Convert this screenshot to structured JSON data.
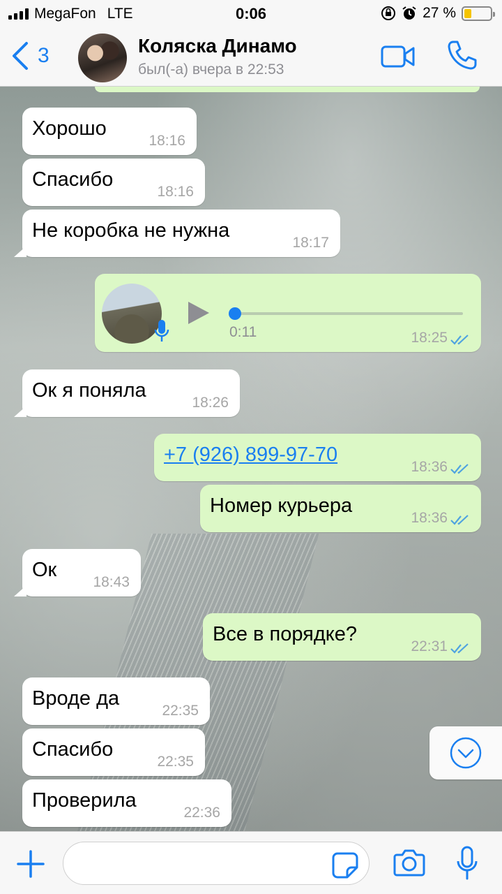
{
  "status_bar": {
    "carrier": "MegaFon",
    "network": "LTE",
    "time": "0:06",
    "battery_percent": "27 %",
    "battery_level": 0.27
  },
  "header": {
    "back_count": "3",
    "contact_name": "Коляска Динамо",
    "last_seen": "был(-а) вчера в 22:53"
  },
  "messages": [
    {
      "text": "Хорошо",
      "time": "18:16"
    },
    {
      "text": "Спасибо",
      "time": "18:16"
    },
    {
      "text": "Не коробка не нужна",
      "time": "18:17"
    },
    {
      "voice_duration": "0:11",
      "time": "18:25"
    },
    {
      "text": "Ок я поняла",
      "time": "18:26"
    },
    {
      "text": "+7 (926) 899-97-70",
      "time": "18:36"
    },
    {
      "text": "Номер курьера",
      "time": "18:36"
    },
    {
      "text": "Ок",
      "time": "18:43"
    },
    {
      "text": "Все в порядке?",
      "time": "22:31"
    },
    {
      "text": "Вроде да",
      "time": "22:35"
    },
    {
      "text": "Спасибо",
      "time": "22:35"
    },
    {
      "text": "Проверила",
      "time": "22:36"
    }
  ],
  "icons": {
    "back": "chevron-left-icon",
    "video": "video-camera-icon",
    "call": "phone-icon",
    "play": "play-icon",
    "mic": "microphone-icon",
    "read": "double-check-icon",
    "scroll": "chevron-down-circle-icon",
    "plus": "plus-icon",
    "sticker": "sticker-icon",
    "camera": "camera-icon"
  },
  "colors": {
    "accent": "#1a7ff0",
    "outgoing_bubble": "#dcf8c6",
    "incoming_bubble": "#ffffff",
    "battery": "#f5c400"
  }
}
